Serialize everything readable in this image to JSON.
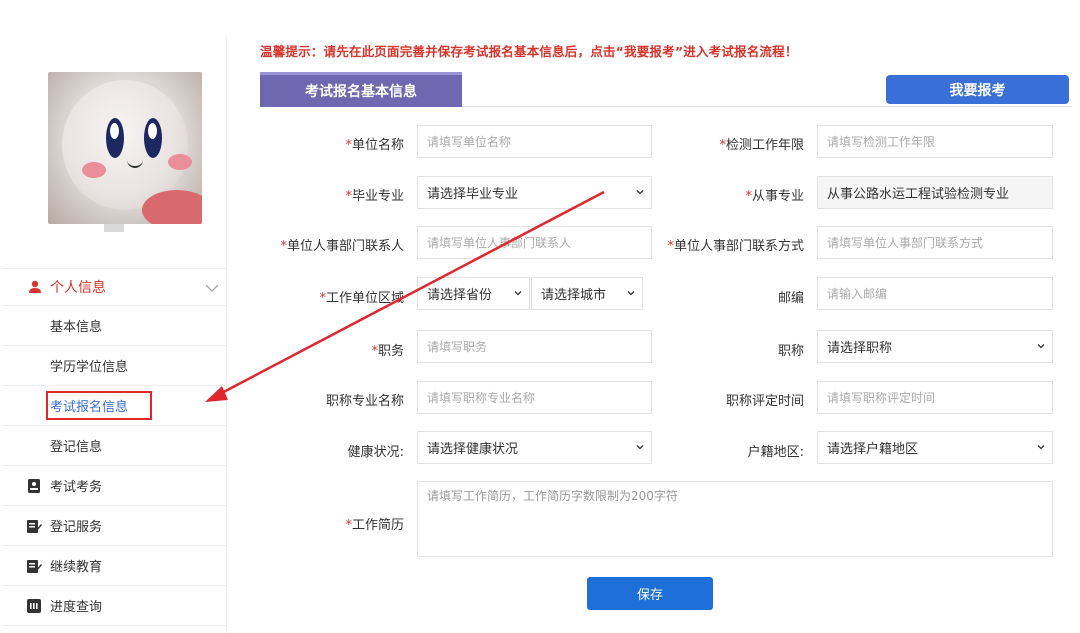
{
  "notice": "温馨提示：请先在此页面完善并保存考试报名基本信息后，点击“我要报考”进入考试报名流程！",
  "tab_title": "考试报名基本信息",
  "apply_button": "我要报考",
  "sidebar": {
    "menu_head": "个人信息",
    "sub_items": [
      "基本信息",
      "学历学位信息",
      "考试报名信息",
      "登记信息"
    ],
    "sections": [
      "考试考务",
      "登记服务",
      "继续教育",
      "进度查询"
    ]
  },
  "form": {
    "unit_name": {
      "label": "单位名称",
      "placeholder": "请填写单位名称"
    },
    "work_years": {
      "label": "检测工作年限",
      "placeholder": "请填写检测工作年限"
    },
    "major": {
      "label": "毕业专业",
      "value": "请选择毕业专业"
    },
    "profession": {
      "label": "从事专业",
      "value": "从事公路水运工程试验检测专业"
    },
    "hr_contact": {
      "label": "单位人事部门联系人",
      "placeholder": "请填写单位人事部门联系人"
    },
    "hr_phone": {
      "label": "单位人事部门联系方式",
      "placeholder": "请填写单位人事部门联系方式"
    },
    "region": {
      "label": "工作单位区域",
      "province": "请选择省份",
      "city": "请选择城市"
    },
    "postcode": {
      "label": "邮编",
      "placeholder": "请输入邮编"
    },
    "position": {
      "label": "职务",
      "placeholder": "请填写职务"
    },
    "title": {
      "label": "职称",
      "value": "请选择职称"
    },
    "title_major": {
      "label": "职称专业名称",
      "placeholder": "请填写职称专业名称"
    },
    "title_date": {
      "label": "职称评定时间",
      "placeholder": "请填写职称评定时间"
    },
    "health": {
      "label": "健康状况:",
      "value": "请选择健康状况"
    },
    "household": {
      "label": "户籍地区:",
      "value": "请选择户籍地区"
    },
    "resume": {
      "label": "工作简历",
      "placeholder": "请填写工作简历，工作简历字数限制为200字符"
    }
  },
  "save_button": "保存",
  "colors": {
    "accent": "#6f67b0",
    "primary": "#1f6fd8",
    "required": "#d9342b"
  }
}
